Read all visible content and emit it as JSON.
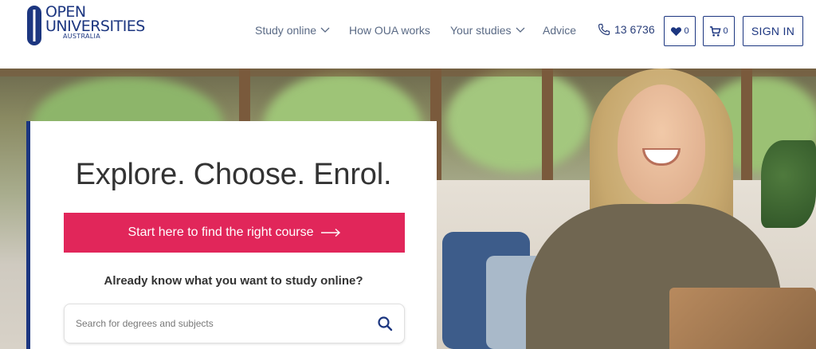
{
  "brand": {
    "line1": "OPEN",
    "line2": "UNIVERSITIES",
    "line3": "AUSTRALIA",
    "color": "#1c3680"
  },
  "nav": {
    "study_online": "Study online",
    "how_oua_works": "How OUA works",
    "your_studies": "Your studies",
    "advice": "Advice",
    "phone": "13 6736",
    "favourites_count": "0",
    "cart_count": "0",
    "sign_in": "SIGN IN"
  },
  "hero": {
    "title": "Explore. Choose. Enrol.",
    "cta_label": "Start here to find the right course",
    "cta_color": "#e1265a",
    "prompt": "Already know what you want to study online?",
    "search_placeholder": "Search for degrees and subjects"
  }
}
